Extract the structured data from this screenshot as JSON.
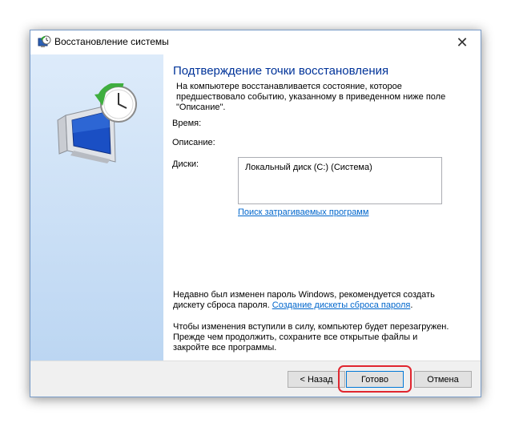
{
  "window": {
    "title": "Восстановление системы",
    "app_icon": "system-restore-icon",
    "close_icon": "close-icon"
  },
  "content": {
    "heading": "Подтверждение точки восстановления",
    "intro_line1": "На компьютере восстанавливается состояние, которое",
    "intro_line2": "предшествовало событию, указанному в приведенном ниже поле",
    "intro_line3": "\"Описание\".",
    "time_label": "Время:",
    "description_label": "Описание:",
    "disks_label": "Диски:",
    "disks": [
      "Локальный диск (C:) (Система)"
    ],
    "find_programs_link": "Поиск затрагиваемых программ",
    "password_line1": "Недавно был изменен пароль Windows, рекомендуется создать",
    "password_line2_prefix": "дискету сброса пароля.",
    "password_link": "Создание дискеты сброса пароля",
    "password_suffix": ".",
    "reboot_line1": "Чтобы изменения вступили в силу, компьютер будет перезагружен.",
    "reboot_line2": "Прежде чем продолжить, сохраните все открытые файлы и",
    "reboot_line3": "закройте все программы."
  },
  "buttons": {
    "back": "< Назад",
    "finish": "Готово",
    "cancel": "Отмена"
  },
  "colors": {
    "heading": "#003399",
    "link": "#0066cc",
    "highlight": "#e0262f",
    "panel_top": "#ddebfa",
    "panel_bottom": "#bcd6f2"
  }
}
